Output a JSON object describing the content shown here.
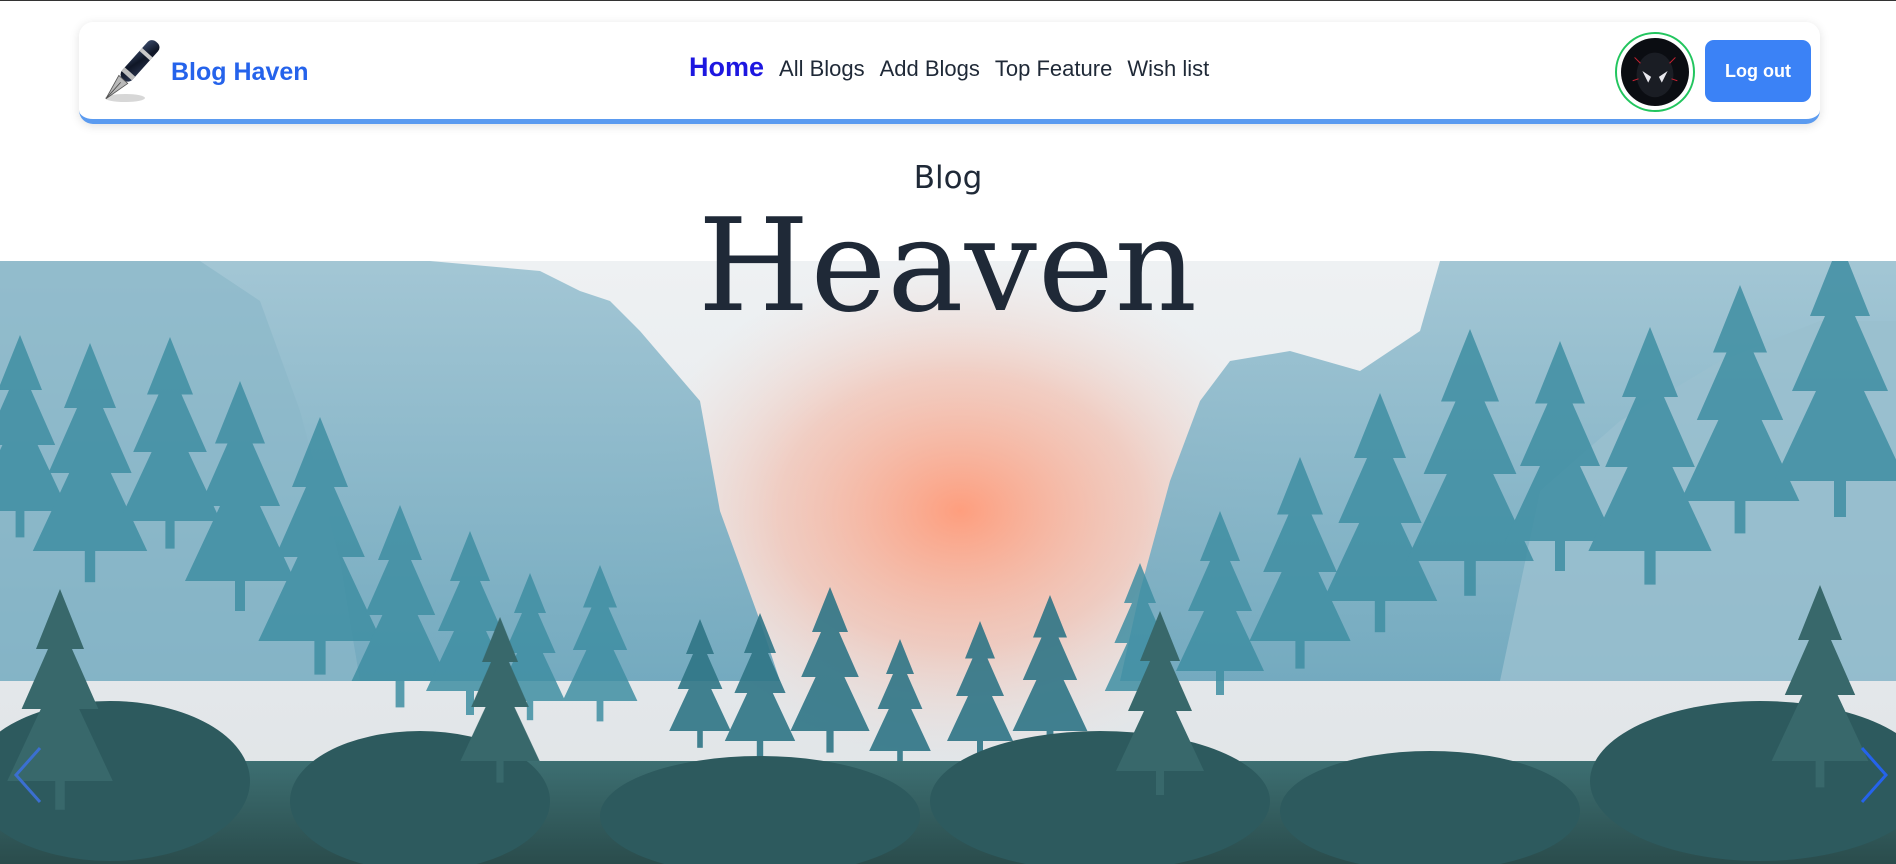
{
  "brand": {
    "name": "Blog Haven",
    "logo_icon": "fountain-pen-icon"
  },
  "nav": {
    "links": [
      {
        "label": "Home",
        "active": true
      },
      {
        "label": "All Blogs",
        "active": false
      },
      {
        "label": "Add Blogs",
        "active": false
      },
      {
        "label": "Top Feature",
        "active": false
      },
      {
        "label": "Wish list",
        "active": false
      }
    ],
    "logout_label": "Log out"
  },
  "hero": {
    "subtitle": "Blog",
    "title": "Heaven",
    "prev_icon": "chevron-left-icon",
    "next_icon": "chevron-right-icon"
  },
  "colors": {
    "brand_blue": "#2563eb",
    "active_link": "#1d17e0",
    "logout_bg": "#3b82f6",
    "navbar_border": "#5b9bf0",
    "avatar_ring": "#22c55e"
  }
}
